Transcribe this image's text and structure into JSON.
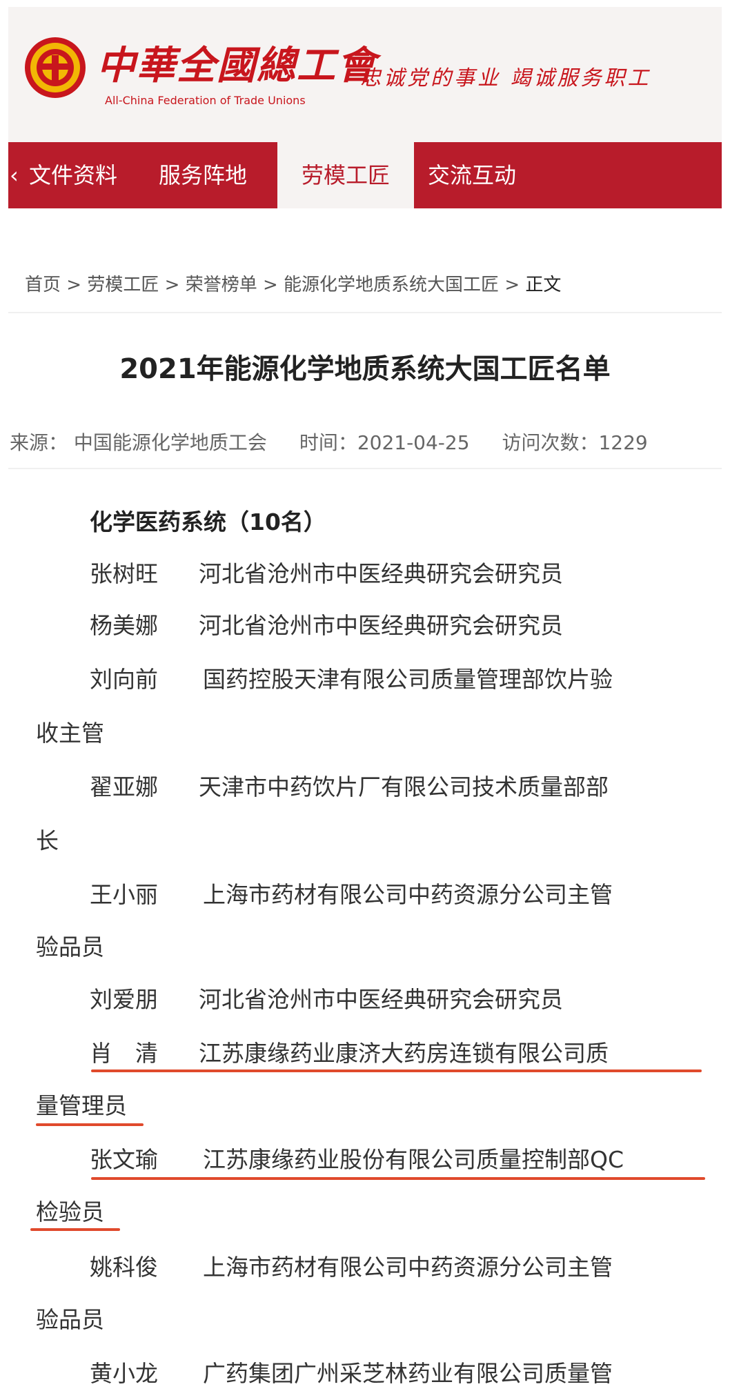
{
  "header": {
    "logo_cn": "中華全國總工會",
    "logo_en": "All-China Federation of Trade Unions",
    "slogan": "忠诚党的事业  竭诚服务职工"
  },
  "nav": {
    "back_symbol": "‹",
    "tabs": [
      {
        "label": "文件资料",
        "active": false
      },
      {
        "label": "服务阵地",
        "active": false
      },
      {
        "label": "劳模工匠",
        "active": true
      },
      {
        "label": "交流互动",
        "active": false
      }
    ]
  },
  "breadcrumb": {
    "items": [
      "首页",
      "劳模工匠",
      "荣誉榜单",
      "能源化学地质系统大国工匠"
    ],
    "separator": ">",
    "current": "正文"
  },
  "article": {
    "title": "2021年能源化学地质系统大国工匠名单",
    "source": "来源：  中国能源化学地质工会",
    "time": "时间：2021-04-25",
    "visits": "访问次数：1229"
  },
  "content": {
    "heading": "化学医药系统（10名）",
    "entries": [
      {
        "name": "张树旺",
        "line1": "河北省沧州市中医经典研究会研究员",
        "line2": ""
      },
      {
        "name": "杨美娜",
        "line1": "河北省沧州市中医经典研究会研究员",
        "line2": ""
      },
      {
        "name": "刘向前",
        "line1": "国药控股天津有限公司质量管理部饮片验",
        "line2": "收主管"
      },
      {
        "name": "翟亚娜",
        "line1": "天津市中药饮片厂有限公司技术质量部部",
        "line2": "长"
      },
      {
        "name": "王小丽",
        "line1": "上海市药材有限公司中药资源分公司主管",
        "line2": "验品员"
      },
      {
        "name": "刘爱朋",
        "line1": "河北省沧州市中医经典研究会研究员",
        "line2": ""
      },
      {
        "name": "肖　清",
        "line1": "江苏康缘药业康济大药房连锁有限公司质",
        "line2": "量管理员"
      },
      {
        "name": "张文瑜",
        "line1": "江苏康缘药业股份有限公司质量控制部QC",
        "line2": "检验员"
      },
      {
        "name": "姚科俊",
        "line1": "上海市药材有限公司中药资源分公司主管",
        "line2": "验品员"
      },
      {
        "name": "黄小龙",
        "line1": "广药集团广州采芝林药业有限公司质量管",
        "line2": ""
      }
    ]
  },
  "colors": {
    "brand_red": "#b81c2b",
    "logo_red": "#c8161d",
    "logo_yellow": "#f2b705",
    "highlight_underline": "#e04a2c"
  }
}
